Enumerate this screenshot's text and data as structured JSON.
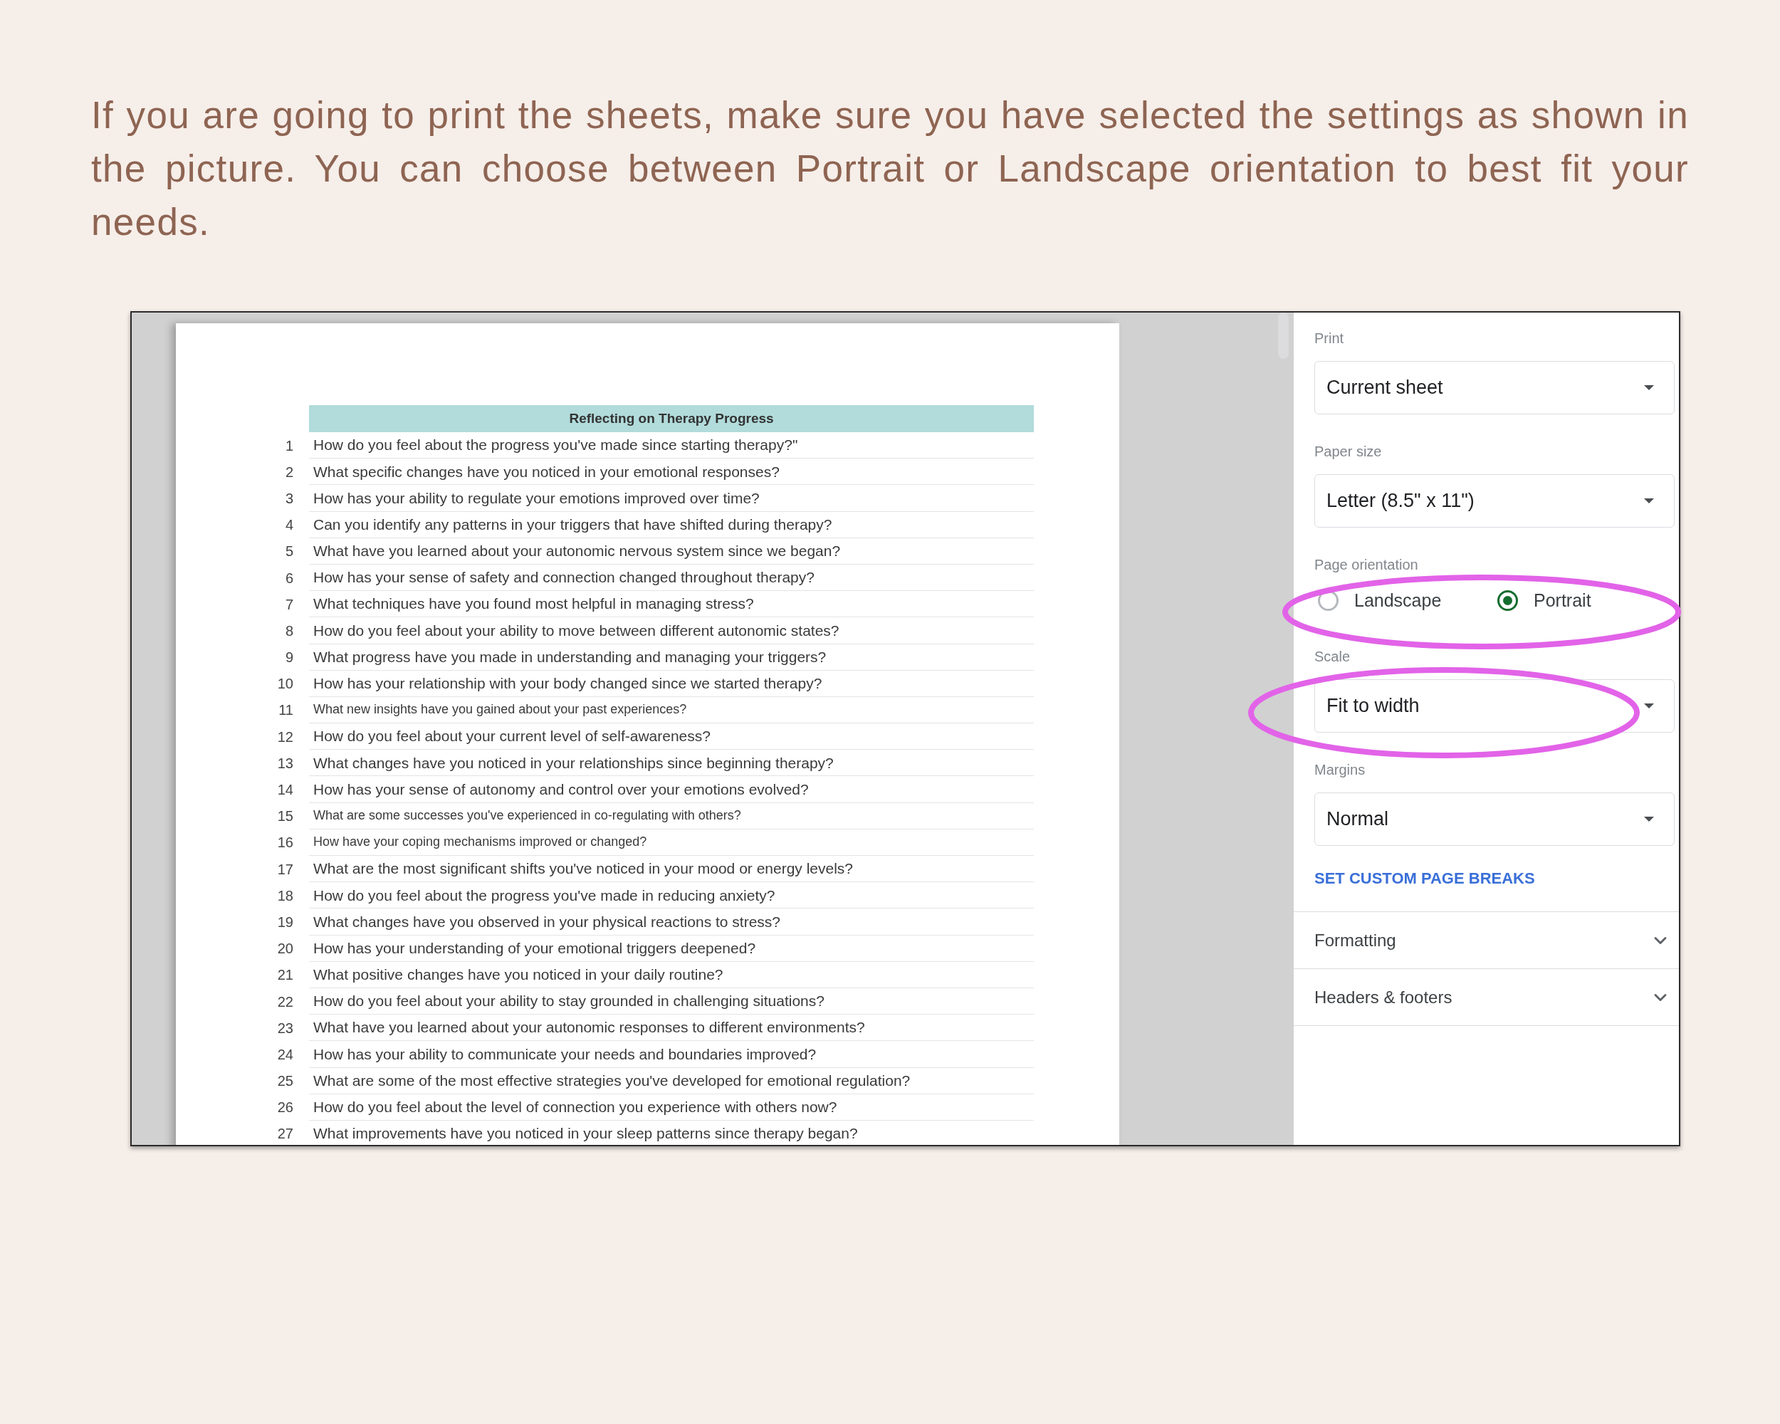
{
  "intro": {
    "text": "If you are going to print the sheets, make sure you have selected the settings as shown in the picture. You can choose between Portrait or Landscape orientation to best fit your needs."
  },
  "screenshot": {
    "sheet": {
      "title": "Reflecting on Therapy Progress",
      "rows": [
        {
          "number": "1",
          "question": "How do you feel about the progress you've made since starting therapy?\"",
          "small": false
        },
        {
          "number": "2",
          "question": "What specific changes have you noticed in your emotional responses?",
          "small": false
        },
        {
          "number": "3",
          "question": "How has your ability to regulate your emotions improved over time?",
          "small": false
        },
        {
          "number": "4",
          "question": "Can you identify any patterns in your triggers that have shifted during therapy?",
          "small": false
        },
        {
          "number": "5",
          "question": "What have you learned about your autonomic nervous system since we began?",
          "small": false
        },
        {
          "number": "6",
          "question": "How has your sense of safety and connection changed throughout therapy?",
          "small": false
        },
        {
          "number": "7",
          "question": "What techniques have you found most helpful in managing stress?",
          "small": false
        },
        {
          "number": "8",
          "question": "How do you feel about your ability to move between different autonomic states?",
          "small": false
        },
        {
          "number": "9",
          "question": "What progress have you made in understanding and managing your triggers?",
          "small": false
        },
        {
          "number": "10",
          "question": "How has your relationship with your body changed since we started therapy?",
          "small": false
        },
        {
          "number": "11",
          "question": "What new insights have you gained about your past experiences?",
          "small": true
        },
        {
          "number": "12",
          "question": "How do you feel about your current level of self-awareness?",
          "small": false
        },
        {
          "number": "13",
          "question": "What changes have you noticed in your relationships since beginning therapy?",
          "small": false
        },
        {
          "number": "14",
          "question": "How has your sense of autonomy and control over your emotions evolved?",
          "small": false
        },
        {
          "number": "15",
          "question": "What are some successes you've experienced in co-regulating with others?",
          "small": true
        },
        {
          "number": "16",
          "question": "How have your coping mechanisms improved or changed?",
          "small": true
        },
        {
          "number": "17",
          "question": "What are the most significant shifts you've noticed in your mood or energy levels?",
          "small": false
        },
        {
          "number": "18",
          "question": "How do you feel about the progress you've made in reducing anxiety?",
          "small": false
        },
        {
          "number": "19",
          "question": "What changes have you observed in your physical reactions to stress?",
          "small": false
        },
        {
          "number": "20",
          "question": "How has your understanding of your emotional triggers deepened?",
          "small": false
        },
        {
          "number": "21",
          "question": "What positive changes have you noticed in your daily routine?",
          "small": false
        },
        {
          "number": "22",
          "question": "How do you feel about your ability to stay grounded in challenging situations?",
          "small": false
        },
        {
          "number": "23",
          "question": "What have you learned about your autonomic responses to different environments?",
          "small": false
        },
        {
          "number": "24",
          "question": "How has your ability to communicate your needs and boundaries improved?",
          "small": false
        },
        {
          "number": "25",
          "question": "What are some of the most effective strategies you've developed for emotional regulation?",
          "small": false
        },
        {
          "number": "26",
          "question": "How do you feel about the level of connection you experience with others now?",
          "small": false
        },
        {
          "number": "27",
          "question": "What improvements have you noticed in your sleep patterns since therapy began?",
          "small": false
        }
      ]
    },
    "print_settings": {
      "fields": [
        {
          "kind": "select",
          "label": "Print",
          "value": "Current sheet",
          "highlighted": false
        },
        {
          "kind": "select",
          "label": "Paper size",
          "value": "Letter (8.5\" x 11\")",
          "highlighted": false
        },
        {
          "kind": "radio",
          "label": "Page orientation",
          "highlighted": true,
          "options": [
            {
              "label": "Landscape",
              "selected": false
            },
            {
              "label": "Portrait",
              "selected": true
            }
          ]
        },
        {
          "kind": "select",
          "label": "Scale",
          "value": "Fit to width",
          "highlighted": true
        },
        {
          "kind": "select",
          "label": "Margins",
          "value": "Normal",
          "highlighted": false
        }
      ],
      "link": "SET CUSTOM PAGE BREAKS",
      "sections": [
        {
          "label": "Formatting",
          "expanded": false
        },
        {
          "label": "Headers & footers",
          "expanded": false
        }
      ]
    }
  }
}
